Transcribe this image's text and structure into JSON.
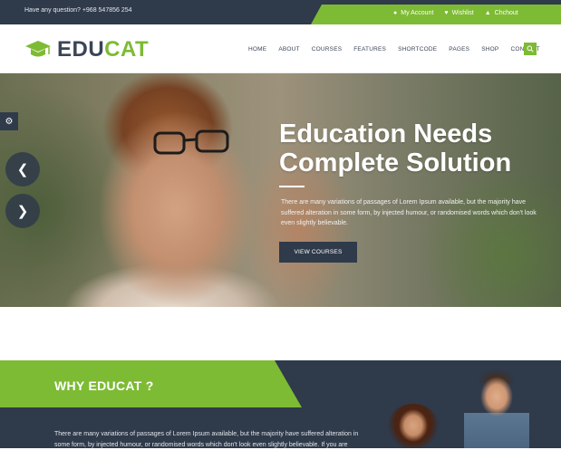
{
  "topbar": {
    "question": "Have any question? +968 547856 254",
    "links": [
      {
        "icon": "user-icon",
        "label": "My Account"
      },
      {
        "icon": "heart-icon",
        "label": "Wishlist"
      },
      {
        "icon": "basket-icon",
        "label": "Chchout"
      }
    ]
  },
  "header": {
    "logo_part1": "EDU",
    "logo_part2": "CAT",
    "nav": [
      "HOME",
      "ABOUT",
      "COURSES",
      "FEATURES",
      "SHORTCODE",
      "PAGES",
      "SHOP",
      "CONTACT"
    ]
  },
  "hero": {
    "title_line1": "Education Needs",
    "title_line2": "Complete Solution",
    "description": "There are many variations of passages of Lorem Ipsum available, but the majority have suffered alteration in some form, by injected humour, or randomised words which don't look even slightly believable.",
    "button": "VIEW COURSES"
  },
  "why": {
    "title": "WHY EDUCAT ?",
    "text": "There are many variations of passages of Lorem Ipsum available, but the majority have suffered alteration in some form, by injected humour, or randomised words which don't look even slightly believable. If you are"
  },
  "colors": {
    "accent": "#7dbb34",
    "dark": "#2f3a4a"
  }
}
